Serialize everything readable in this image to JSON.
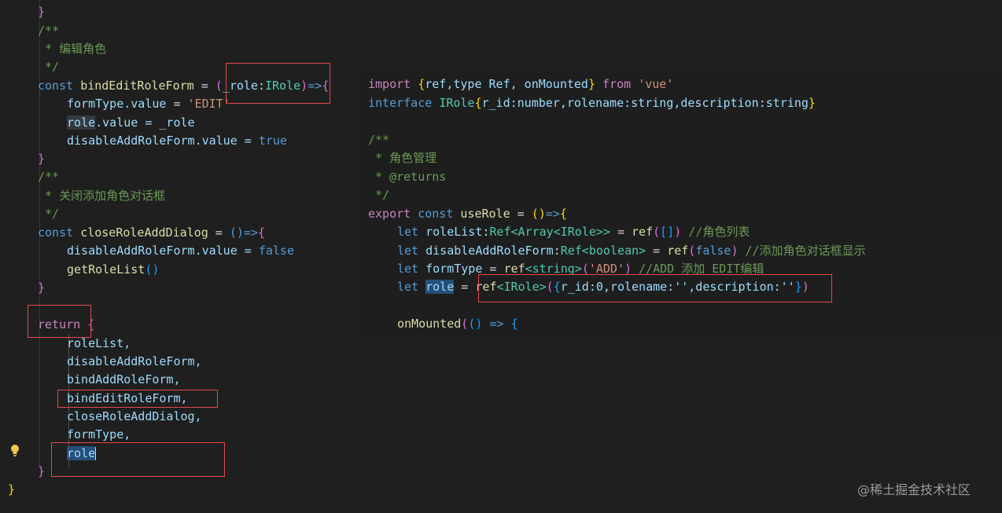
{
  "left_code": {
    "line_close_brace_top": "}",
    "comment_edit_open": "/**",
    "comment_edit_text": " * 编辑角色",
    "comment_edit_close": " */",
    "kw_const": "const",
    "bind_edit_name": "bindEditRoleForm",
    "eq": " = ",
    "param_name": "_role",
    "param_type": "IRole",
    "arrow": "=>",
    "formtype_stmt_var": "formType",
    "formtype_stmt_prop": ".value",
    "formtype_val": "'EDIT'",
    "role_stmt_var": "role",
    "role_stmt_rest": ".value = _role",
    "disable_stmt_var": "disableAddRoleForm",
    "disable_stmt_prop": ".value = ",
    "true_val": "true",
    "close_brace": "}",
    "comment_close_open": "/**",
    "comment_close_text": " * 关闭添加角色对话框",
    "comment_close_close": " */",
    "close_dialog_name": "closeRoleAddDialog",
    "arrow_fn": "()=>",
    "false_val": "false",
    "get_role_list": "getRoleList",
    "return_kw": "return",
    "returns": [
      "roleList,",
      "disableAddRoleForm,",
      "bindAddRoleForm,",
      "bindEditRoleForm,",
      "closeRoleAddDialog,",
      "formType,",
      "role"
    ],
    "final_brace": "}"
  },
  "popup_code": {
    "import_kw": "import",
    "import_names": "ref,type Ref, onMounted",
    "from_kw": "from",
    "import_src": "'vue'",
    "interface_kw": "interface",
    "iface_name": "IRole",
    "iface_body": "r_id:number,rolename:string,description:string",
    "c_open": "/**",
    "c_line1": " * 角色管理",
    "c_line2": " * @returns",
    "c_close": " */",
    "export_kw": "export",
    "const_kw": "const",
    "use_role": "useRole",
    "let_kw": "let",
    "rolelist_decl": "roleList",
    "rolelist_type": "Ref<Array<IRole>>",
    "rolelist_comment": "//角色列表",
    "disable_decl": "disableAddRoleForm",
    "disable_type": "Ref<boolean>",
    "disable_comment": "//添加角色对话框显示",
    "formtype_decl": "formType",
    "formtype_arg": "'ADD'",
    "formtype_comment": "//ADD 添加 EDIT编辑",
    "role_decl": "role",
    "role_obj": "r_id:0,rolename:'',description:''",
    "on_mounted": "onMounted"
  },
  "watermark": "@稀土掘金技术社区",
  "colors": {
    "highlight_box": "#e5484d",
    "background": "#1f1f1f"
  }
}
